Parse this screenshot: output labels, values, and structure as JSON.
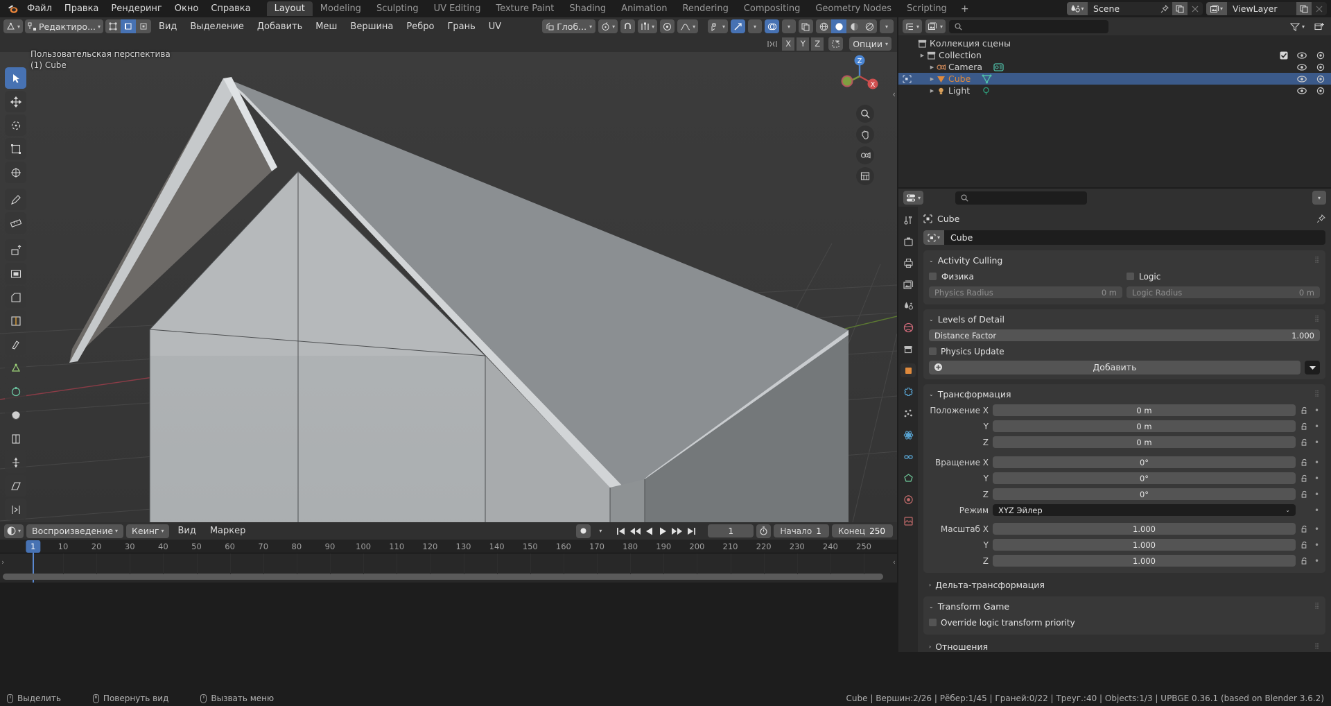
{
  "topbar": {
    "app_menus": [
      "Файл",
      "Правка",
      "Рендеринг",
      "Окно",
      "Справка"
    ],
    "workspaces": [
      "Layout",
      "Modeling",
      "Sculpting",
      "UV Editing",
      "Texture Paint",
      "Shading",
      "Animation",
      "Rendering",
      "Compositing",
      "Geometry Nodes",
      "Scripting"
    ],
    "active_workspace": "Layout",
    "add_workspace": "+",
    "scene_name": "Scene",
    "viewlayer_name": "ViewLayer"
  },
  "viewport_header": {
    "mode": "Редактиро...",
    "menus": [
      "Вид",
      "Выделение",
      "Добавить",
      "Меш",
      "Вершина",
      "Ребро",
      "Грань",
      "UV"
    ],
    "transform_orientation": "Глоб...",
    "options_label": "Опции",
    "axis_buttons": [
      "X",
      "Y",
      "Z"
    ]
  },
  "viewport": {
    "view_name": "Пользовательская перспектива",
    "object_line": "(1) Cube",
    "gizmo_axes": {
      "z": "Z",
      "x": "X"
    }
  },
  "outliner": {
    "root_label": "Коллекция сцены",
    "items": [
      {
        "label": "Collection",
        "depth": 1,
        "selected": false,
        "checkbox": true
      },
      {
        "label": "Camera",
        "depth": 2,
        "selected": false,
        "checkbox": false
      },
      {
        "label": "Cube",
        "depth": 2,
        "selected": true,
        "checkbox": false
      },
      {
        "label": "Light",
        "depth": 2,
        "selected": false,
        "checkbox": false
      }
    ]
  },
  "properties": {
    "breadcrumb_object": "Cube",
    "object_name_field": "Cube",
    "panels": [
      {
        "title": "Activity Culling"
      },
      {
        "title": "Levels of Detail"
      },
      {
        "title": "Трансформация"
      },
      {
        "title": "Дельта-трансформация"
      },
      {
        "title": "Transform Game"
      },
      {
        "title": "Отношения"
      }
    ],
    "activity_culling": {
      "physics_label": "Физика",
      "logic_label": "Logic",
      "physics_radius_label": "Physics Radius",
      "physics_radius_value": "0 m",
      "logic_radius_label": "Logic Radius",
      "logic_radius_value": "0 m"
    },
    "levels_of_detail": {
      "distance_factor_label": "Distance Factor",
      "distance_factor_value": "1.000",
      "physics_update_label": "Physics Update",
      "add_label": "Добавить"
    },
    "transform": {
      "location_label": "Положение X",
      "location": [
        "0 m",
        "0 m",
        "0 m"
      ],
      "rotation_label": "Вращение X",
      "rotation": [
        "0°",
        "0°",
        "0°"
      ],
      "mode_label": "Режим",
      "mode_value": "XYZ Эйлер",
      "scale_label": "Масштаб X",
      "scale": [
        "1.000",
        "1.000",
        "1.000"
      ],
      "axis_y": "Y",
      "axis_z": "Z"
    },
    "transform_game": {
      "override_label": "Override logic transform priority"
    }
  },
  "timeline": {
    "menus": [
      "Воспроизведение",
      "Кеинг",
      "Вид",
      "Маркер"
    ],
    "current_frame": "1",
    "start_label": "Начало",
    "start_value": "1",
    "end_label": "Конец",
    "end_value": "250",
    "ticks": [
      10,
      20,
      30,
      40,
      50,
      60,
      70,
      80,
      90,
      100,
      110,
      120,
      130,
      140,
      150,
      160,
      170,
      180,
      190,
      200,
      210,
      220,
      230,
      240,
      250
    ]
  },
  "statusbar": {
    "hints": [
      "Выделить",
      "Повернуть вид",
      "Вызвать меню"
    ],
    "info": "Cube | Вершин:2/26 | Рёбер:1/45 | Граней:0/22 | Треуг.:40 | Objects:1/3 | UPBGE 0.36.1 (based on Blender 3.6.2)"
  },
  "colors": {
    "accent": "#4772b3",
    "selection_orange": "#e08a3c",
    "panel_bg": "#303030",
    "widget": "#545454"
  }
}
